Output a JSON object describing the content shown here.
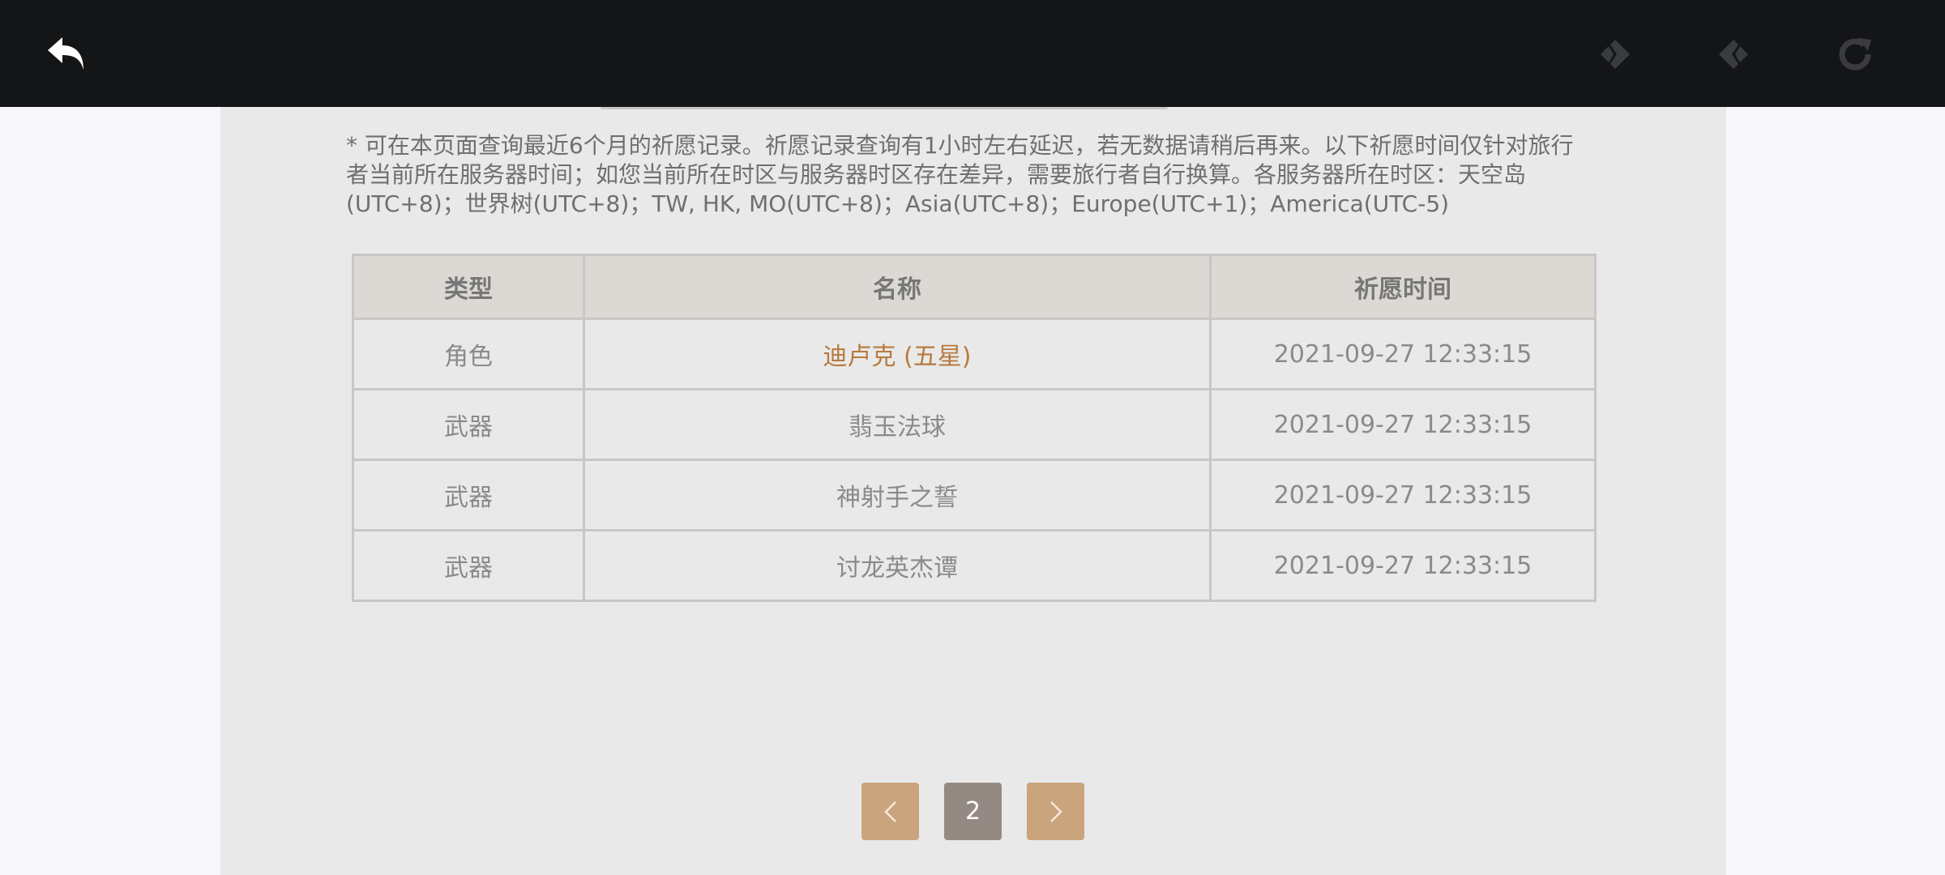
{
  "topbar": {
    "icons": {
      "back": "back-arrow-icon",
      "prev": "prev-diamond-icon",
      "next": "next-diamond-icon",
      "reload": "reload-icon"
    }
  },
  "notice": "* 可在本页面查询最近6个月的祈愿记录。祈愿记录查询有1小时左右延迟，若无数据请稍后再来。以下祈愿时间仅针对旅行者当前所在服务器时间；如您当前所在时区与服务器时区存在差异，需要旅行者自行换算。各服务器所在时区：天空岛(UTC+8)；世界树(UTC+8)；TW, HK, MO(UTC+8)；Asia(UTC+8)；Europe(UTC+1)；America(UTC-5)",
  "table": {
    "headers": [
      "类型",
      "名称",
      "祈愿时间"
    ],
    "rows": [
      {
        "type": "角色",
        "name": "迪卢克 (五星)",
        "time": "2021-09-27 12:33:15"
      },
      {
        "type": "武器",
        "name": "翡玉法球",
        "time": "2021-09-27 12:33:15"
      },
      {
        "type": "武器",
        "name": "神射手之誓",
        "time": "2021-09-27 12:33:15"
      },
      {
        "type": "武器",
        "name": "讨龙英杰谭",
        "time": "2021-09-27 12:33:15"
      }
    ]
  },
  "pagination": {
    "prev_icon": "chevron-left-icon",
    "current_page": "2",
    "next_icon": "chevron-right-icon"
  },
  "colors": {
    "topbar_bg": "#141517",
    "panel_bg": "#e9e9e9",
    "highlight_five_star": "#b77a3e",
    "pager_active": "#c9a47d",
    "pager_current": "#958a83"
  }
}
